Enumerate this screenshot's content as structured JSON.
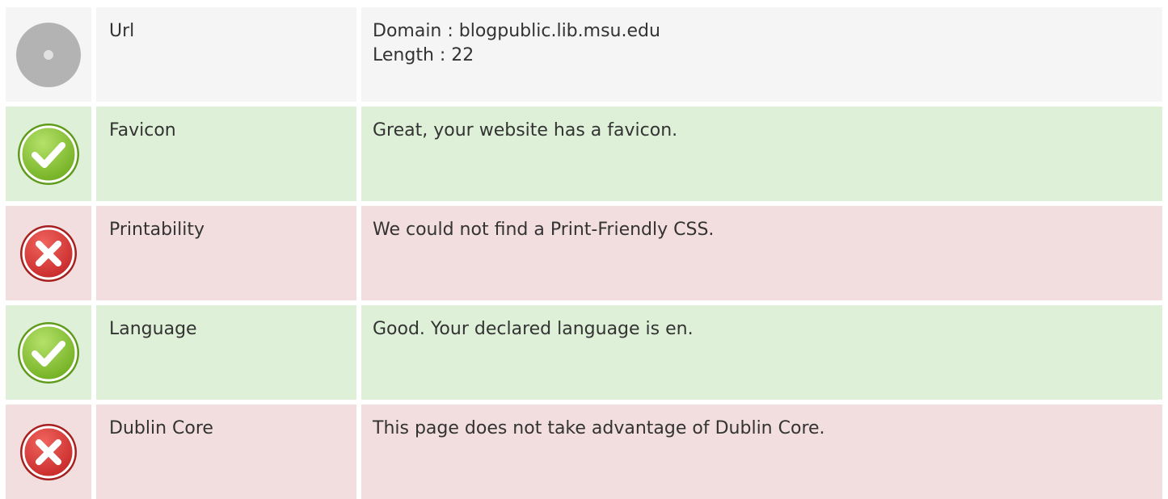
{
  "rows": [
    {
      "status": "neutral",
      "icon": "neutral-circle-icon",
      "label": "Url",
      "lines": [
        "Domain : blogpublic.lib.msu.edu",
        "Length : 22"
      ]
    },
    {
      "status": "good",
      "icon": "check-circle-icon",
      "label": "Favicon",
      "lines": [
        "Great, your website has a favicon."
      ]
    },
    {
      "status": "bad",
      "icon": "cross-circle-icon",
      "label": "Printability",
      "lines": [
        "We could not find a Print-Friendly CSS."
      ]
    },
    {
      "status": "good",
      "icon": "check-circle-icon",
      "label": "Language",
      "lines": [
        "Good. Your declared language is en."
      ]
    },
    {
      "status": "bad",
      "icon": "cross-circle-icon",
      "label": "Dublin Core",
      "lines": [
        "This page does not take advantage of Dublin Core."
      ]
    }
  ],
  "colors": {
    "good_bg": "#dff0d8",
    "bad_bg": "#f2dede",
    "neutral_bg": "#f5f5f5",
    "check_green": "#8cc63f",
    "cross_red": "#e53935",
    "neutral_gray": "#b3b3b3"
  }
}
